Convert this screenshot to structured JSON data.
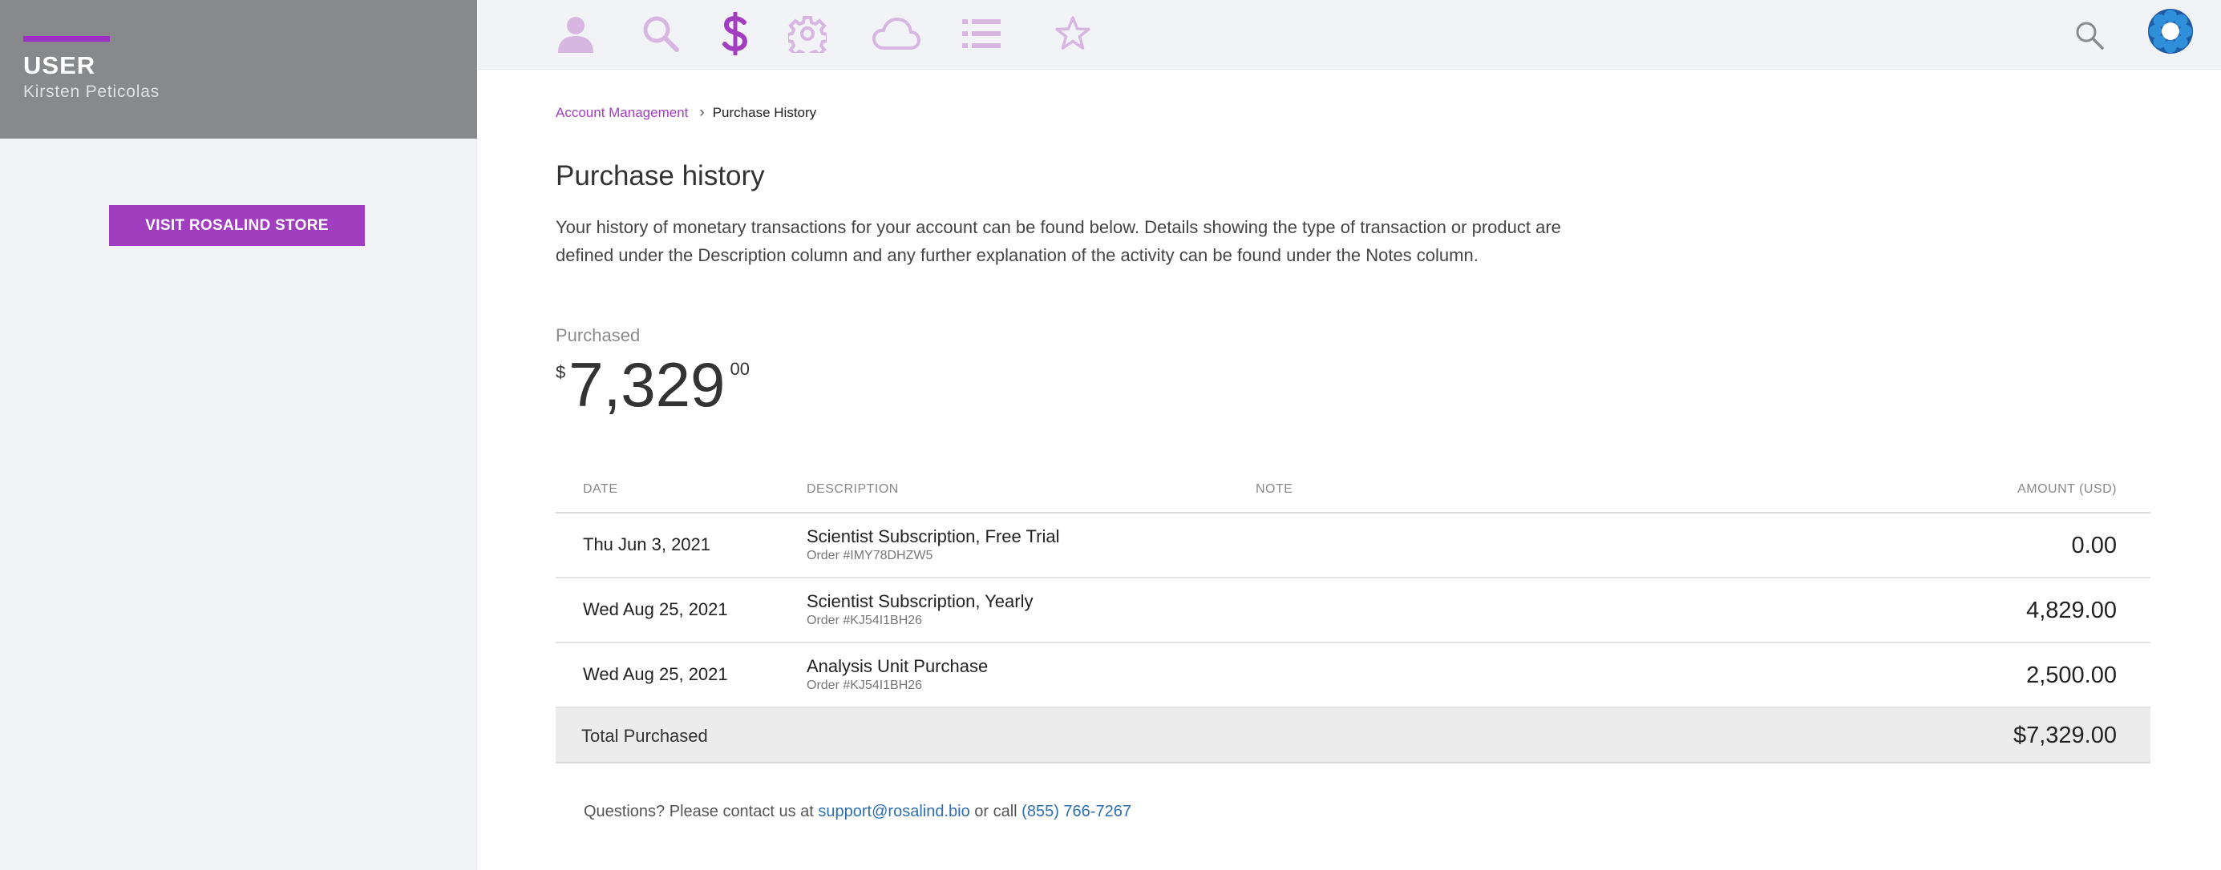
{
  "sidebar": {
    "user_label": "USER",
    "user_name": "Kirsten Peticolas",
    "store_button": "VISIT ROSALIND STORE"
  },
  "topnav": {
    "icons": [
      {
        "name": "user-icon",
        "active": false
      },
      {
        "name": "search-icon",
        "active": false
      },
      {
        "name": "dollar-icon",
        "active": true
      },
      {
        "name": "gear-icon",
        "active": false
      },
      {
        "name": "cloud-icon",
        "active": false
      },
      {
        "name": "list-icon",
        "active": false
      },
      {
        "name": "star-icon",
        "active": false
      }
    ],
    "accent_color": "#a13ec0",
    "inactive_color": "#d7b6e2"
  },
  "breadcrumb": {
    "parent": "Account Management",
    "separator": "›",
    "current": "Purchase History"
  },
  "page": {
    "title": "Purchase history",
    "intro": "Your history of monetary transactions for your account can be found below. Details showing the type of transaction or product are defined under the Description column and any further explanation of the activity can be found under the Notes column."
  },
  "summary": {
    "label": "Purchased",
    "currency": "$",
    "amount": "7,329",
    "cents": "00"
  },
  "table": {
    "headers": {
      "date": "DATE",
      "description": "DESCRIPTION",
      "note": "NOTE",
      "amount": "AMOUNT (USD)"
    },
    "rows": [
      {
        "date": "Thu Jun 3, 2021",
        "description": "Scientist Subscription, Free Trial",
        "order": "Order #IMY78DHZW5",
        "note": "",
        "amount": "0.00"
      },
      {
        "date": "Wed Aug 25, 2021",
        "description": "Scientist Subscription, Yearly",
        "order": "Order #KJ54I1BH26",
        "note": "",
        "amount": "4,829.00"
      },
      {
        "date": "Wed Aug 25, 2021",
        "description": "Analysis Unit Purchase",
        "order": "Order #KJ54I1BH26",
        "note": "",
        "amount": "2,500.00"
      }
    ],
    "total_label": "Total Purchased",
    "total_amount": "$7,329.00"
  },
  "contact": {
    "prefix": "Questions? Please contact us at ",
    "email": "support@rosalind.bio",
    "middle": " or call ",
    "phone": "(855) 766-7267"
  }
}
